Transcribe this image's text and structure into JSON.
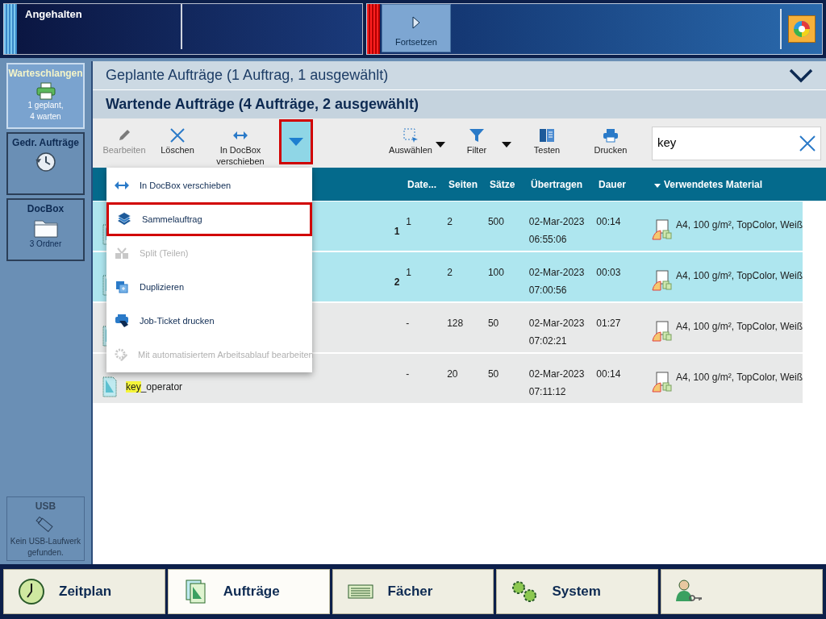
{
  "status_panel": {
    "state": "Angehalten",
    "resume_button": "Fortsetzen"
  },
  "sidebar": [
    {
      "title": "Warteschlangen",
      "kind": "queue",
      "lines": [
        "1 geplant,",
        "4 warten"
      ],
      "selected": true,
      "disabled": false
    },
    {
      "title": "Gedr. Aufträge",
      "kind": "history",
      "selected": false,
      "disabled": false
    },
    {
      "title": "DocBox",
      "kind": "folder",
      "lines": [
        "3 Ordner"
      ],
      "selected": false,
      "disabled": false
    },
    {
      "title": "USB",
      "kind": "usb",
      "lines": [
        "Kein USB-Laufwerk",
        "gefunden."
      ],
      "selected": false,
      "disabled": true
    }
  ],
  "scheduled_header": "Geplante Aufträge (1 Auftrag, 1 ausgewählt)",
  "waiting_header": "Wartende Aufträge (4 Aufträge, 2 ausgewählt)",
  "toolbar": [
    {
      "label": "Bearbeiten",
      "kind": "edit",
      "disabled": true
    },
    {
      "label": "Löschen",
      "kind": "delete",
      "disabled": false
    },
    {
      "label": "In DocBox\nverschieben",
      "kind": "move",
      "disabled": false
    },
    {
      "label": "Auswählen",
      "kind": "select",
      "disabled": false
    },
    {
      "label": "Filter",
      "kind": "filter",
      "disabled": false
    },
    {
      "label": "Testen",
      "kind": "test",
      "disabled": false
    },
    {
      "label": "Drucken",
      "kind": "print",
      "disabled": false
    }
  ],
  "search": {
    "value": "key"
  },
  "table": {
    "columns": [
      "Date...",
      "Seiten",
      "Sätze",
      "Übertragen",
      "Dauer",
      "Verwendetes Material"
    ],
    "rows": [
      {
        "selected": true,
        "number": "1",
        "cells": [
          "1",
          "2",
          "500",
          "02-Mar-2023\n06:55:06",
          "00:14",
          "A4, 100 g/m², TopColor, Weiß"
        ]
      },
      {
        "selected": true,
        "number": "2",
        "cells": [
          "1",
          "2",
          "100",
          "02-Mar-2023\n07:00:56",
          "00:03",
          "A4, 100 g/m², TopColor, Weiß"
        ]
      },
      {
        "selected": false,
        "cells": [
          "-",
          "128",
          "50",
          "02-Mar-2023\n07:02:21",
          "01:27",
          "A4, 100 g/m², TopColor, Weiß"
        ]
      },
      {
        "selected": false,
        "owner_parts": [
          {
            "text": "key",
            "highlighted": true
          },
          {
            "text": "_operator",
            "highlighted": false
          }
        ],
        "cells": [
          "-",
          "20",
          "50",
          "02-Mar-2023\n07:11:12",
          "00:14",
          "A4, 100 g/m², TopColor, Weiß"
        ]
      }
    ]
  },
  "more_menu": [
    {
      "label": "In DocBox verschieben",
      "kind": "move",
      "disabled": false,
      "selected": false
    },
    {
      "label": "Sammelauftrag",
      "kind": "merge",
      "disabled": false,
      "selected": true
    },
    {
      "label": "Split (Teilen)",
      "kind": "split",
      "disabled": true,
      "selected": false
    },
    {
      "label": "Duplizieren",
      "kind": "duplicate",
      "disabled": false,
      "selected": false
    },
    {
      "label": "Job-Ticket drucken",
      "kind": "ticket",
      "disabled": false,
      "selected": false
    },
    {
      "label": "Mit automatisiertem Arbeitsablauf bearbeiten",
      "kind": "workflow",
      "disabled": true,
      "selected": false
    }
  ],
  "bottom_tabs": [
    {
      "label": "Zeitplan",
      "kind": "clock",
      "selected": false
    },
    {
      "label": "Aufträge",
      "kind": "jobs",
      "selected": true
    },
    {
      "label": "Fächer",
      "kind": "trays",
      "selected": false
    },
    {
      "label": "System",
      "kind": "gears",
      "selected": false
    },
    {
      "kind": "user",
      "selected": false
    }
  ]
}
